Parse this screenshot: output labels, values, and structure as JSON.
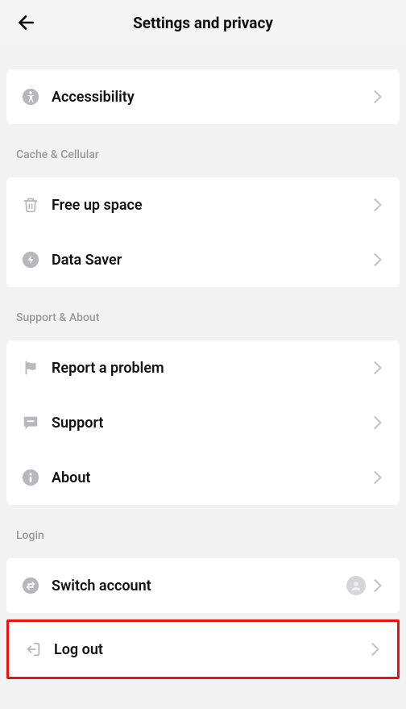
{
  "header": {
    "title": "Settings and privacy"
  },
  "sections": {
    "top": {
      "items": {
        "accessibility": {
          "label": "Accessibility"
        }
      }
    },
    "cache": {
      "label": "Cache & Cellular",
      "items": {
        "free_space": {
          "label": "Free up space"
        },
        "data_saver": {
          "label": "Data Saver"
        }
      }
    },
    "support": {
      "label": "Support & About",
      "items": {
        "report": {
          "label": "Report a problem"
        },
        "support": {
          "label": "Support"
        },
        "about": {
          "label": "About"
        }
      }
    },
    "login": {
      "label": "Login",
      "items": {
        "switch": {
          "label": "Switch account"
        },
        "logout": {
          "label": "Log out"
        }
      }
    }
  },
  "colors": {
    "icon_gray": "#b7b7bc",
    "label_gray": "#9a9a9d",
    "highlight": "#e11"
  }
}
